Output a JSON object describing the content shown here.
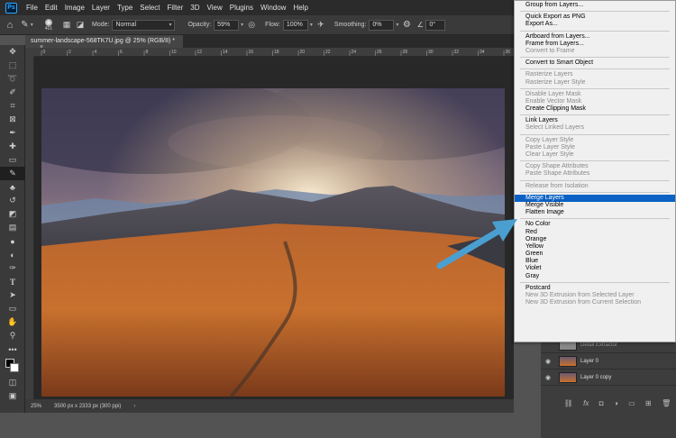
{
  "app": {
    "logo": "Ps"
  },
  "menubar": [
    "File",
    "Edit",
    "Image",
    "Layer",
    "Type",
    "Select",
    "Filter",
    "3D",
    "View",
    "Plugins",
    "Window",
    "Help"
  ],
  "options": {
    "brush_size": "401",
    "mode_label": "Mode:",
    "mode_value": "Normal",
    "opacity_label": "Opacity:",
    "opacity_value": "59%",
    "flow_label": "Flow:",
    "flow_value": "100%",
    "smoothing_label": "Smoothing:",
    "smoothing_value": "0%",
    "angle_value": "0°"
  },
  "document": {
    "tab_title": "summer-landscape-568TK7U.jpg @ 25% (RGB/8) *",
    "close": "×"
  },
  "ruler_ticks": [
    "0",
    "2",
    "4",
    "6",
    "8",
    "10",
    "12",
    "14",
    "16",
    "18",
    "20",
    "22",
    "24",
    "26",
    "28",
    "30",
    "32",
    "34",
    "36"
  ],
  "status": {
    "zoom": "25%",
    "size": "3500 px x 2333 px (300 ppi)"
  },
  "context_menu": [
    {
      "label": "Group from Layers...",
      "disabled": false
    },
    {
      "sep": true
    },
    {
      "label": "Quick Export as PNG",
      "disabled": false
    },
    {
      "label": "Export As...",
      "disabled": false
    },
    {
      "sep": true
    },
    {
      "label": "Artboard from Layers...",
      "disabled": false
    },
    {
      "label": "Frame from Layers...",
      "disabled": false
    },
    {
      "label": "Convert to Frame",
      "disabled": true
    },
    {
      "sep": true
    },
    {
      "label": "Convert to Smart Object",
      "disabled": false
    },
    {
      "sep": true
    },
    {
      "label": "Rasterize Layers",
      "disabled": true
    },
    {
      "label": "Rasterize Layer Style",
      "disabled": true
    },
    {
      "sep": true
    },
    {
      "label": "Disable Layer Mask",
      "disabled": true
    },
    {
      "label": "Enable Vector Mask",
      "disabled": true
    },
    {
      "label": "Create Clipping Mask",
      "disabled": false
    },
    {
      "sep": true
    },
    {
      "label": "Link Layers",
      "disabled": false
    },
    {
      "label": "Select Linked Layers",
      "disabled": true
    },
    {
      "sep": true
    },
    {
      "label": "Copy Layer Style",
      "disabled": true
    },
    {
      "label": "Paste Layer Style",
      "disabled": true
    },
    {
      "label": "Clear Layer Style",
      "disabled": true
    },
    {
      "sep": true
    },
    {
      "label": "Copy Shape Attributes",
      "disabled": true
    },
    {
      "label": "Paste Shape Attributes",
      "disabled": true
    },
    {
      "sep": true
    },
    {
      "label": "Release from Isolation",
      "disabled": true
    },
    {
      "sep": true
    },
    {
      "label": "Merge Layers",
      "disabled": false,
      "highlighted": true
    },
    {
      "label": "Merge Visible",
      "disabled": false
    },
    {
      "label": "Flatten Image",
      "disabled": false
    },
    {
      "sep": true
    },
    {
      "label": "No Color",
      "disabled": false
    },
    {
      "label": "Red",
      "disabled": false
    },
    {
      "label": "Orange",
      "disabled": false
    },
    {
      "label": "Yellow",
      "disabled": false
    },
    {
      "label": "Green",
      "disabled": false
    },
    {
      "label": "Blue",
      "disabled": false
    },
    {
      "label": "Violet",
      "disabled": false
    },
    {
      "label": "Gray",
      "disabled": false
    },
    {
      "sep": true
    },
    {
      "label": "Postcard",
      "disabled": false
    },
    {
      "label": "New 3D Extrusion from Selected Layer",
      "disabled": true
    },
    {
      "label": "New 3D Extrusion from Current Selection",
      "disabled": true
    }
  ],
  "layers": [
    {
      "name": "Detail Extractor",
      "dim": true
    },
    {
      "name": "Layer 0",
      "dim": false
    },
    {
      "name": "Layer 0 copy",
      "dim": false
    }
  ],
  "colors": {
    "accent": "#0b61c4",
    "arrow": "#4a9fd0",
    "panel_bg": "#535353",
    "menu_bg": "#f0f0f0"
  }
}
